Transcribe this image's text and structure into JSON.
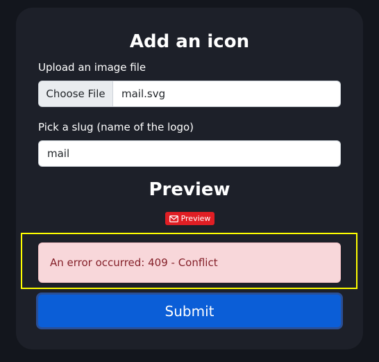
{
  "form": {
    "title": "Add an icon",
    "upload_label": "Upload an image file",
    "file_button_label": "Choose File",
    "file_name": "mail.svg",
    "slug_label": "Pick a slug (name of the logo)",
    "slug_value": "mail",
    "preview_heading": "Preview",
    "badge": {
      "icon": "mail-icon",
      "label": "Preview",
      "color": "#e01e24"
    },
    "error_message": "An error occurred: 409 - Conflict",
    "submit_label": "Submit"
  },
  "colors": {
    "background": "#13161d",
    "card": "#1d2029",
    "submit": "#0b5ed7",
    "error_bg": "#f8d7da",
    "error_text": "#842029",
    "highlight": "#ffff00"
  }
}
